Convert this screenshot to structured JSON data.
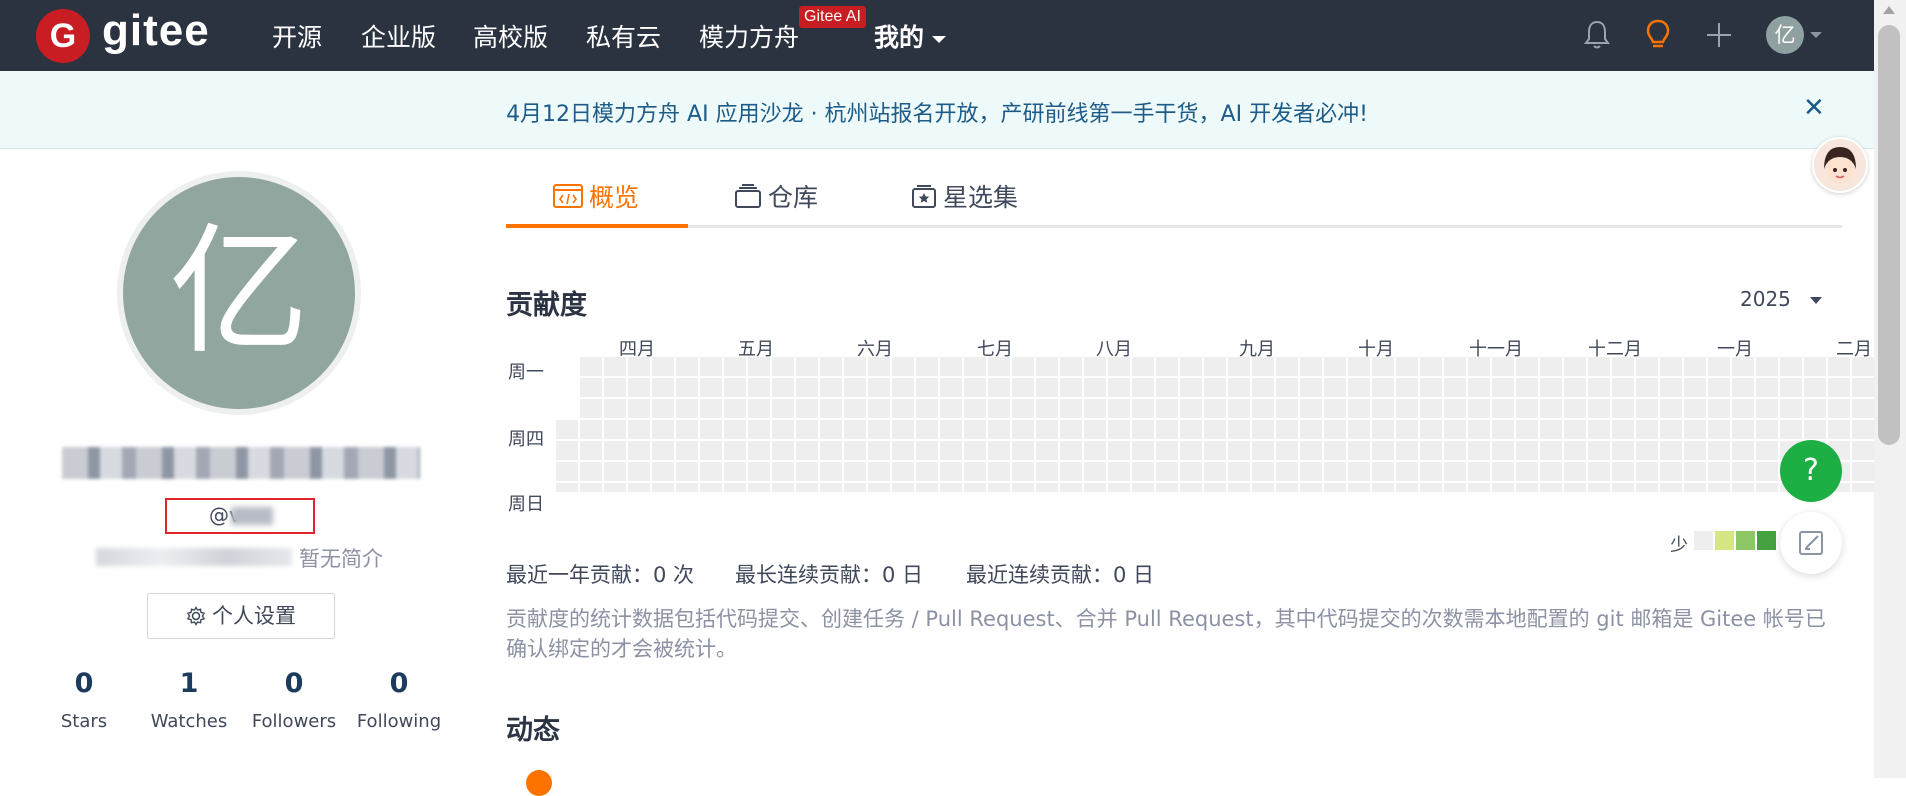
{
  "header": {
    "logo_letter": "G",
    "logo_text": "gitee",
    "nav": [
      "开源",
      "企业版",
      "高校版",
      "私有云",
      "模力方舟",
      "我的"
    ],
    "ai_badge": "Gitee AI",
    "avatar_letter": "亿",
    "icons": [
      "bell-icon",
      "lightbulb-icon",
      "plus-icon",
      "chevron-down-icon"
    ],
    "accent": "#fe7300",
    "brand": "#c71d23"
  },
  "banner": {
    "text": "4月12日模力方舟 AI 应用沙龙 · 杭州站报名开放，产研前线第一手干货，AI 开发者必冲!",
    "close": "✕"
  },
  "profile": {
    "avatar_letter": "亿",
    "username_prefix": "@v",
    "bio_suffix": "暂无简介",
    "settings_label": "个人设置",
    "stats": [
      {
        "value": "0",
        "label": "Stars"
      },
      {
        "value": "1",
        "label": "Watches"
      },
      {
        "value": "0",
        "label": "Followers"
      },
      {
        "value": "0",
        "label": "Following"
      }
    ]
  },
  "tabs": [
    {
      "label": "概览",
      "icon": "code-window-icon",
      "active": true
    },
    {
      "label": "仓库",
      "icon": "repo-stack-icon",
      "active": false
    },
    {
      "label": "星选集",
      "icon": "star-box-icon",
      "active": false
    }
  ],
  "contribution": {
    "title": "贡献度",
    "year": "2025",
    "months": [
      "四月",
      "五月",
      "六月",
      "七月",
      "八月",
      "九月",
      "十月",
      "十一月",
      "十二月",
      "一月",
      "二月"
    ],
    "weekdays": [
      "周一",
      "周四",
      "周日"
    ],
    "legend_label": "少",
    "legend_colors": [
      "#eeeeee",
      "#d6e685",
      "#8cc665",
      "#44a340"
    ],
    "stats": [
      "最近一年贡献：0 次",
      "最长连续贡献：0 日",
      "最近连续贡献：0 日"
    ],
    "description": "贡献度的统计数据包括代码提交、创建任务 / Pull Request、合并 Pull Request，其中代码提交的次数需本地配置的 git 邮箱是 Gitee 帐号已确认绑定的才会被统计。"
  },
  "activity": {
    "title": "动态"
  },
  "floating": {
    "help": "?"
  }
}
